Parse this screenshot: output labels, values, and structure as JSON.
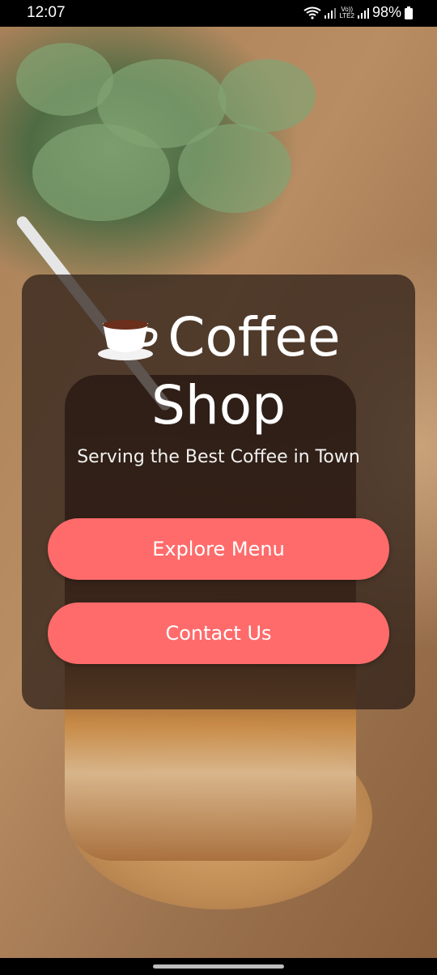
{
  "status": {
    "time": "12:07",
    "battery": "98%",
    "network": "LTE2",
    "icons": [
      "wifi-icon",
      "signal-icon",
      "volte-icon",
      "signal-icon",
      "battery-icon"
    ]
  },
  "hero": {
    "icon": "coffee-cup-icon",
    "title": "Coffee Shop",
    "subtitle": "Serving the Best Coffee in Town"
  },
  "actions": {
    "explore_label": "Explore Menu",
    "contact_label": "Contact Us"
  },
  "colors": {
    "button": "#ff6b6b",
    "card": "rgba(40,28,22,0.72)"
  }
}
